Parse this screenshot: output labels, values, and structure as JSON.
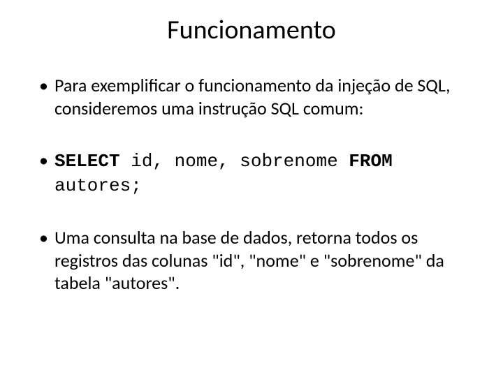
{
  "title": "Funcionamento",
  "bullet1": {
    "part1": "Para exemplificar o funcionamento da injeção de SQL, consideremos uma instrução ",
    "sql_word": "SQL",
    "part2": " comum:"
  },
  "bullet2": {
    "kw_select": "SELECT",
    "cols": " id, nome, sobrenome ",
    "kw_from": "FROM",
    "table": " autores;"
  },
  "bullet3": {
    "part1": "Uma ",
    "consulta": "consulta",
    "part2": " na base de dados, retorna todos os registros das colunas \"id\", \"nome\" e \"sobrenome\" da tabela \"autores\"."
  }
}
